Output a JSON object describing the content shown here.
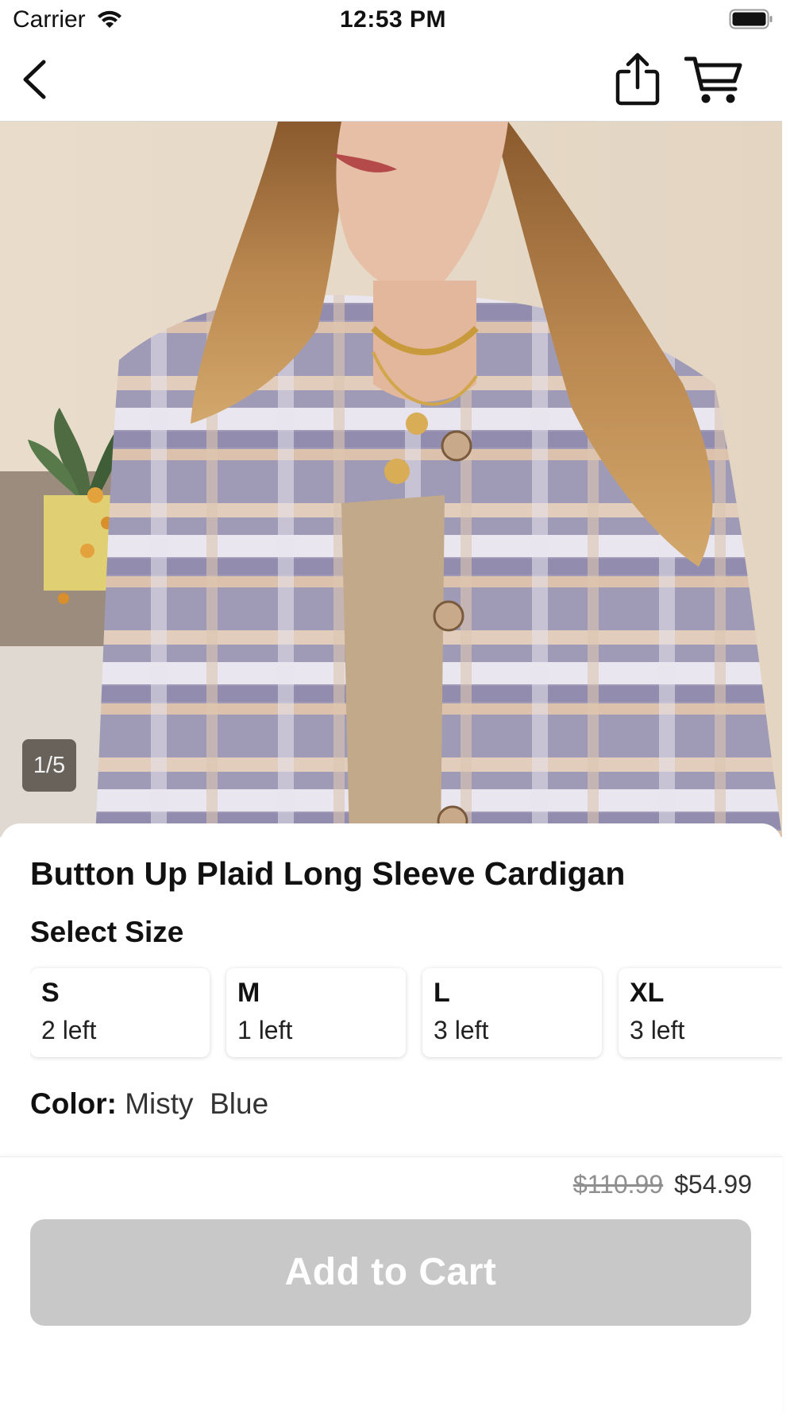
{
  "status_bar": {
    "carrier": "Carrier",
    "time": "12:53 PM",
    "wifi_icon": "wifi-icon",
    "battery_icon": "battery-full-icon"
  },
  "nav": {
    "back_icon": "chevron-left-icon",
    "share_icon": "share-icon",
    "cart_icon": "cart-icon"
  },
  "gallery": {
    "counter": "1/5"
  },
  "product": {
    "title": "Button Up Plaid Long Sleeve Cardigan",
    "size_heading": "Select Size",
    "sizes": [
      {
        "label": "S",
        "stock": "2 left"
      },
      {
        "label": "M",
        "stock": "1 left"
      },
      {
        "label": "L",
        "stock": "3 left"
      },
      {
        "label": "XL",
        "stock": "3 left"
      }
    ],
    "color_label": "Color:",
    "color_value": "Misty  Blue"
  },
  "purchase": {
    "original_price": "$110.99",
    "sale_price": "$54.99",
    "add_to_cart_label": "Add to Cart",
    "button_color": "#c8c8c8"
  }
}
